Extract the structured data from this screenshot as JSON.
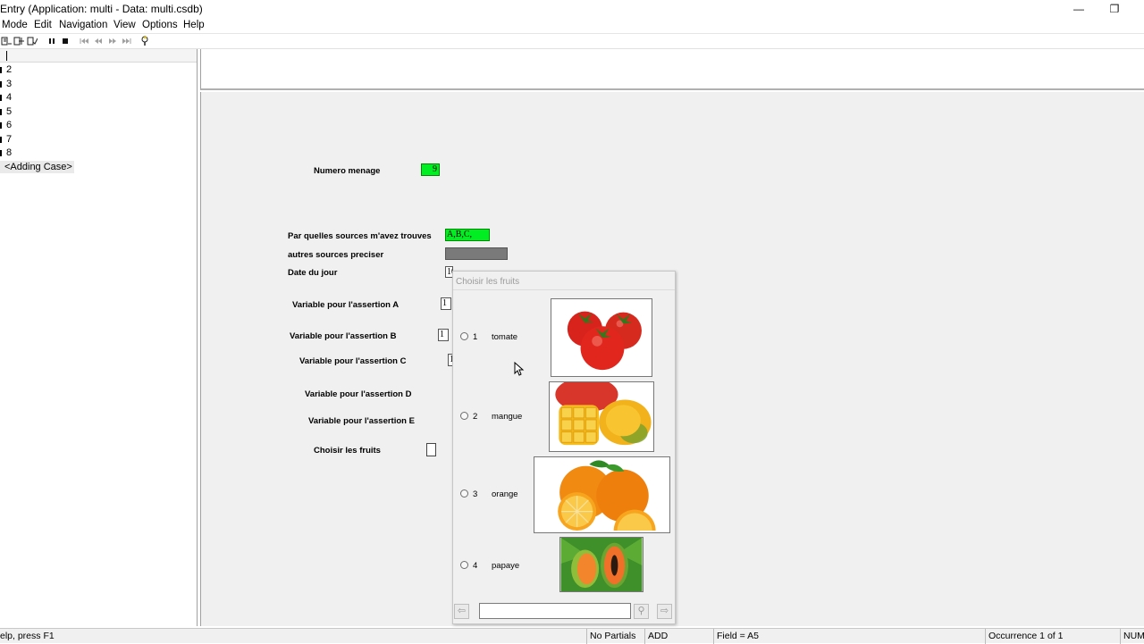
{
  "window": {
    "title": "Entry (Application: multi - Data: multi.csdb)",
    "minimize_glyph": "—",
    "restore_glyph": "❐"
  },
  "menu": [
    "Mode",
    "Edit",
    "Navigation",
    "View",
    "Options",
    "Help"
  ],
  "toolbar": {
    "icons": [
      "add-case-icon",
      "insert-case-icon",
      "modify-case-icon",
      "pause-icon",
      "stop-icon",
      "first-case-icon",
      "previous-case-icon",
      "next-case-icon",
      "last-case-icon",
      "help-icon"
    ]
  },
  "case_tree": {
    "items": [
      "2",
      "3",
      "4",
      "5",
      "6",
      "7",
      "8"
    ],
    "adding_case": "<Adding Case>"
  },
  "form": {
    "numero_menage": {
      "label": "Numero menage",
      "value": "9"
    },
    "sources": {
      "label": "Par quelles sources m'avez trouves",
      "value": "A,B,C,"
    },
    "autres_sources": {
      "label": "autres sources preciser",
      "value": ""
    },
    "date_du_jour": {
      "label": "Date du jour",
      "value": "10022016"
    },
    "assertion_a": {
      "label": "Variable pour l'assertion A",
      "value": "1"
    },
    "assertion_b": {
      "label": "Variable pour l'assertion B",
      "value": "1"
    },
    "assertion_c": {
      "label": "Variable pour l'assertion C",
      "value": "1"
    },
    "assertion_d": {
      "label": "Variable pour l'assertion D"
    },
    "assertion_e": {
      "label": "Variable pour l'assertion E"
    },
    "choisir_fruits": {
      "label": "Choisir les fruits",
      "value": ""
    }
  },
  "popup": {
    "title": "Choisir les fruits",
    "options": [
      {
        "code": "1",
        "label": "tomate",
        "image": "tomato-image"
      },
      {
        "code": "2",
        "label": "mangue",
        "image": "mango-image"
      },
      {
        "code": "3",
        "label": "orange",
        "image": "orange-image"
      },
      {
        "code": "4",
        "label": "papaye",
        "image": "papaya-image"
      }
    ],
    "search_value": "",
    "back_glyph": "⇦",
    "forward_glyph": "⇨",
    "search_glyph": "⚲"
  },
  "status": {
    "help": "elp, press F1",
    "partials": "No Partials",
    "mode": "ADD",
    "field": "Field = A5",
    "occurrence": "Occurrence 1 of 1",
    "numlock": "NUM"
  },
  "colors": {
    "green_field": "#00ee22",
    "grey_field": "#7a7a7a",
    "form_bg": "#f0f0f0"
  }
}
